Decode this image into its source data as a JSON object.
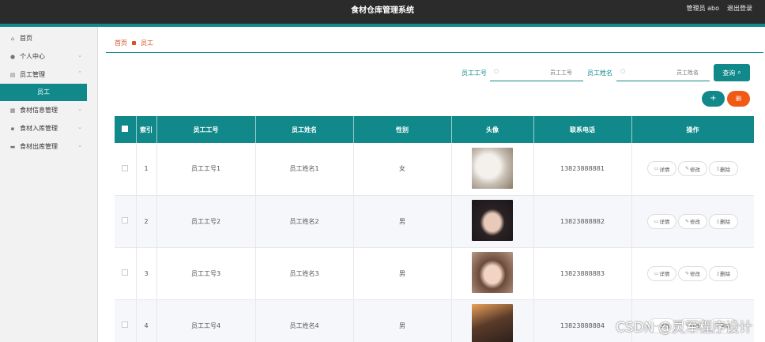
{
  "header": {
    "title": "食材仓库管理系统",
    "user_role": "管理员",
    "username": "abo",
    "logout": "退出登录"
  },
  "sidebar": {
    "items": [
      {
        "label": "首页",
        "icon": "home-icon",
        "expandable": false
      },
      {
        "label": "个人中心",
        "icon": "user-icon",
        "expandable": true
      },
      {
        "label": "员工管理",
        "icon": "building-icon",
        "expandable": true
      },
      {
        "label": "员工",
        "sub": true,
        "active": true
      },
      {
        "label": "食材信息管理",
        "icon": "list-icon",
        "expandable": true
      },
      {
        "label": "食材入库管理",
        "icon": "grid-icon",
        "expandable": true
      },
      {
        "label": "食材出库管理",
        "icon": "box-icon",
        "expandable": true
      }
    ]
  },
  "breadcrumb": {
    "home": "首页",
    "current": "员工"
  },
  "search": {
    "label1": "员工工号",
    "placeholder1": "员工工号",
    "label2": "员工姓名",
    "placeholder2": "员工姓名",
    "button": "查询"
  },
  "actions": {
    "add": "+",
    "delete": "删"
  },
  "table": {
    "headers": [
      "",
      "索引",
      "员工工号",
      "员工姓名",
      "性别",
      "头像",
      "联系电话",
      "操作"
    ],
    "op_labels": {
      "detail": "详情",
      "edit": "修改",
      "delete": "删除"
    },
    "rows": [
      {
        "index": "1",
        "emp_no": "员工工号1",
        "emp_name": "员工姓名1",
        "gender": "女",
        "phone": "13823888881",
        "avatar": "cat"
      },
      {
        "index": "2",
        "emp_no": "员工工号2",
        "emp_name": "员工姓名2",
        "gender": "男",
        "phone": "13823888882",
        "avatar": "girl-dark"
      },
      {
        "index": "3",
        "emp_no": "员工工号3",
        "emp_name": "员工姓名3",
        "gender": "男",
        "phone": "13823888883",
        "avatar": "girl-light"
      },
      {
        "index": "4",
        "emp_no": "员工工号4",
        "emp_name": "员工姓名4",
        "gender": "男",
        "phone": "13823888884",
        "avatar": "girl-sunset"
      }
    ]
  },
  "watermark": "CSDN @灵军程序设计",
  "colors": {
    "accent": "#11898a",
    "danger": "#f05a14",
    "topbar": "#2b2b2b",
    "breadcrumb": "#d9501f"
  }
}
